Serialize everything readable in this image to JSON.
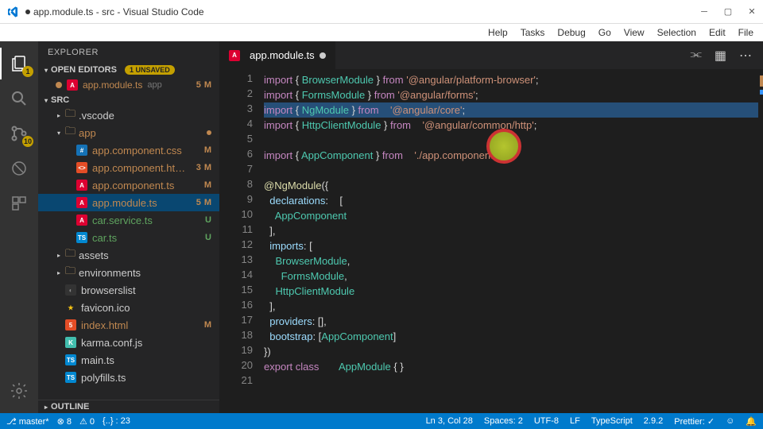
{
  "window_title": "app.module.ts - src - Visual Studio Code",
  "menu": [
    "Help",
    "Tasks",
    "Debug",
    "Go",
    "View",
    "Selection",
    "Edit",
    "File"
  ],
  "activity": {
    "explorer_badge": "1",
    "scm_badge": "10"
  },
  "explorer": {
    "title": "EXPLORER",
    "open_editors": "OPEN EDITORS",
    "unsaved": "1 UNSAVED",
    "open_file": {
      "name": "app.module.ts",
      "hint": "app",
      "num": "5",
      "status": "M"
    },
    "root": "SRC",
    "outline": "OUTLINE"
  },
  "tree": [
    {
      "indent": 1,
      "type": "folder",
      "arrow": "▸",
      "name": ".vscode",
      "cls": ""
    },
    {
      "indent": 1,
      "type": "folder",
      "arrow": "▾",
      "name": "app",
      "cls": "dirty",
      "dot": true
    },
    {
      "indent": 2,
      "type": "file",
      "ico": "f-css",
      "icoTxt": "#",
      "name": "app.component.css",
      "status": "M",
      "cls": "dirty"
    },
    {
      "indent": 2,
      "type": "file",
      "ico": "f-html",
      "icoTxt": "<>",
      "name": "app.component.ht…",
      "num": "3",
      "status": "M",
      "cls": "dirty"
    },
    {
      "indent": 2,
      "type": "file",
      "ico": "f-ng",
      "icoTxt": "A",
      "name": "app.component.ts",
      "status": "M",
      "cls": "dirty"
    },
    {
      "indent": 2,
      "type": "file",
      "ico": "f-ng",
      "icoTxt": "A",
      "name": "app.module.ts",
      "num": "5",
      "status": "M",
      "cls": "dirty",
      "selected": true
    },
    {
      "indent": 2,
      "type": "file",
      "ico": "f-ng",
      "icoTxt": "A",
      "name": "car.service.ts",
      "status": "U",
      "ucolor": true
    },
    {
      "indent": 2,
      "type": "file",
      "ico": "f-ts",
      "icoTxt": "TS",
      "name": "car.ts",
      "status": "U",
      "ucolor": true
    },
    {
      "indent": 1,
      "type": "folder",
      "arrow": "▸",
      "name": "assets",
      "cls": ""
    },
    {
      "indent": 1,
      "type": "folder",
      "arrow": "▸",
      "name": "environments",
      "cls": ""
    },
    {
      "indent": 1,
      "type": "file",
      "ico": "f-json",
      "icoTxt": "◐",
      "name": "browserslist"
    },
    {
      "indent": 1,
      "type": "file",
      "ico": "f-star",
      "icoTxt": "★",
      "name": "favicon.ico"
    },
    {
      "indent": 1,
      "type": "file",
      "ico": "f-html",
      "icoTxt": "5",
      "name": "index.html",
      "status": "M",
      "cls": "dirty"
    },
    {
      "indent": 1,
      "type": "file",
      "ico": "f-karma",
      "icoTxt": "K",
      "name": "karma.conf.js"
    },
    {
      "indent": 1,
      "type": "file",
      "ico": "f-ts",
      "icoTxt": "TS",
      "name": "main.ts"
    },
    {
      "indent": 1,
      "type": "file",
      "ico": "f-ts",
      "icoTxt": "TS",
      "name": "polyfills.ts"
    }
  ],
  "tab": {
    "name": "app.module.ts"
  },
  "code": [
    [
      {
        "t": "import",
        "c": "kw"
      },
      {
        "t": " { ",
        "c": "pun"
      },
      {
        "t": "BrowserModule",
        "c": "cls"
      },
      {
        "t": " } ",
        "c": "pun"
      },
      {
        "t": "from",
        "c": "kw"
      },
      {
        "t": " ",
        "c": ""
      },
      {
        "t": "'@angular/platform-browser'",
        "c": "str"
      },
      {
        "t": ";",
        "c": "pun"
      }
    ],
    [
      {
        "t": "import",
        "c": "kw"
      },
      {
        "t": " { ",
        "c": "pun"
      },
      {
        "t": "FormsModule",
        "c": "cls"
      },
      {
        "t": " } ",
        "c": "pun"
      },
      {
        "t": "from",
        "c": "kw"
      },
      {
        "t": " ",
        "c": ""
      },
      {
        "t": "'@angular/forms'",
        "c": "str"
      },
      {
        "t": ";",
        "c": "pun"
      }
    ],
    [
      {
        "t": "import",
        "c": "kw"
      },
      {
        "t": " { ",
        "c": "pun"
      },
      {
        "t": "NgModule",
        "c": "cls"
      },
      {
        "t": " } ",
        "c": "pun"
      },
      {
        "t": "from",
        "c": "kw"
      },
      {
        "t": "    ",
        "c": ""
      },
      {
        "t": "'@angular/core'",
        "c": "str"
      },
      {
        "t": ";",
        "c": "pun"
      }
    ],
    [
      {
        "t": "import",
        "c": "kw"
      },
      {
        "t": " { ",
        "c": "pun"
      },
      {
        "t": "HttpClientModule",
        "c": "cls"
      },
      {
        "t": " } ",
        "c": "pun"
      },
      {
        "t": "from",
        "c": "kw"
      },
      {
        "t": "    ",
        "c": ""
      },
      {
        "t": "'@angular/common/http'",
        "c": "str"
      },
      {
        "t": ";",
        "c": "pun"
      }
    ],
    [],
    [
      {
        "t": "import",
        "c": "kw"
      },
      {
        "t": " { ",
        "c": "pun"
      },
      {
        "t": "AppComponent",
        "c": "cls"
      },
      {
        "t": " } ",
        "c": "pun"
      },
      {
        "t": "from",
        "c": "kw"
      },
      {
        "t": "    ",
        "c": ""
      },
      {
        "t": "'./app.component'",
        "c": "str"
      },
      {
        "t": ";",
        "c": "pun"
      }
    ],
    [],
    [
      {
        "t": "@",
        "c": "dec"
      },
      {
        "t": "NgModule",
        "c": "dec"
      },
      {
        "t": "({",
        "c": "pun"
      }
    ],
    [
      {
        "t": "  ",
        "c": ""
      },
      {
        "t": "declarations",
        "c": "var"
      },
      {
        "t": ":    [",
        "c": "pun"
      }
    ],
    [
      {
        "t": "    ",
        "c": ""
      },
      {
        "t": "AppComponent",
        "c": "cls"
      }
    ],
    [
      {
        "t": "  ],",
        "c": "pun"
      }
    ],
    [
      {
        "t": "  ",
        "c": ""
      },
      {
        "t": "imports",
        "c": "var"
      },
      {
        "t": ": [",
        "c": "pun"
      }
    ],
    [
      {
        "t": "    ",
        "c": ""
      },
      {
        "t": "BrowserModule",
        "c": "cls"
      },
      {
        "t": ",",
        "c": "pun"
      }
    ],
    [
      {
        "t": "      ",
        "c": ""
      },
      {
        "t": "FormsModule",
        "c": "cls"
      },
      {
        "t": ",",
        "c": "pun"
      }
    ],
    [
      {
        "t": "    ",
        "c": ""
      },
      {
        "t": "HttpClientModule",
        "c": "cls"
      }
    ],
    [
      {
        "t": "  ],",
        "c": "pun"
      }
    ],
    [
      {
        "t": "  ",
        "c": ""
      },
      {
        "t": "providers",
        "c": "var"
      },
      {
        "t": ": [],",
        "c": "pun"
      }
    ],
    [
      {
        "t": "  ",
        "c": ""
      },
      {
        "t": "bootstrap",
        "c": "var"
      },
      {
        "t": ": [",
        "c": "pun"
      },
      {
        "t": "AppComponent",
        "c": "cls"
      },
      {
        "t": "]",
        "c": "pun"
      }
    ],
    [
      {
        "t": "})",
        "c": "pun"
      }
    ],
    [
      {
        "t": "export",
        "c": "kw"
      },
      {
        "t": " ",
        "c": ""
      },
      {
        "t": "class",
        "c": "kw"
      },
      {
        "t": "       ",
        "c": ""
      },
      {
        "t": "AppModule",
        "c": "cls"
      },
      {
        "t": " { }",
        "c": "pun"
      }
    ],
    []
  ],
  "status": {
    "branch": "master*",
    "errors": "⊗ 8",
    "warnings": "⚠ 0",
    "info": "{..} : 23",
    "cursor": "Ln 3, Col 28",
    "spaces": "Spaces: 2",
    "encoding": "UTF-8",
    "eol": "LF",
    "lang": "TypeScript",
    "ver": "2.9.2",
    "prettier": "Prettier: ✓",
    "smile": "☺",
    "bell": "🔔"
  }
}
